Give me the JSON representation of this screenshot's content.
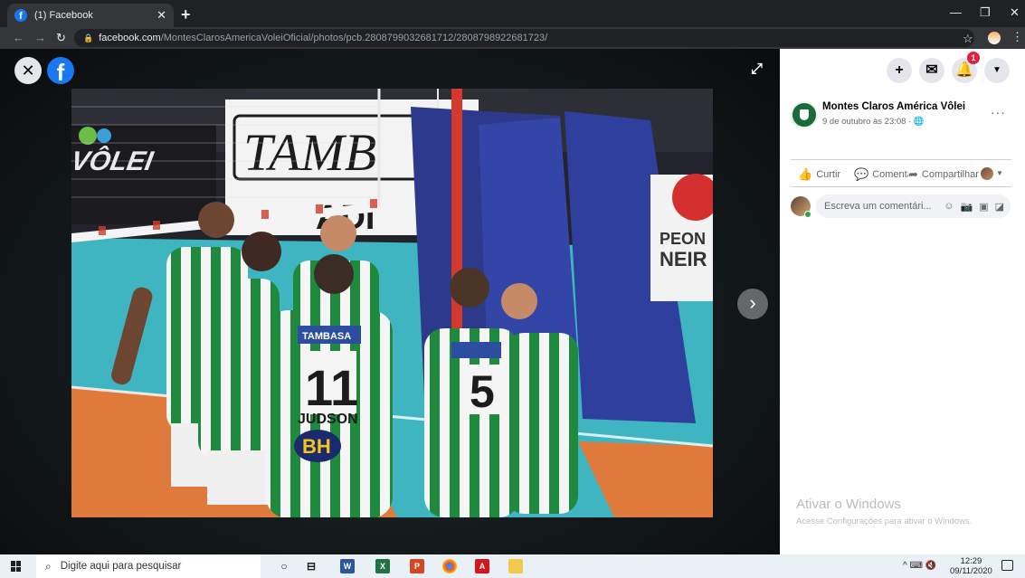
{
  "browser": {
    "tab_title": "(1) Facebook",
    "tab_close": "✕",
    "new_tab": "+",
    "url_host": "facebook.com",
    "url_path": "/MontesClarosAmericaVoleiOficial/photos/pcb.2808799032681712/2808798922681723/"
  },
  "viewer": {
    "close_icon": "✕",
    "logo_letter": "f",
    "expand_icon": "⤢",
    "next_icon": "›",
    "photo_texts": {
      "banner_left": "VÔLEI",
      "banner_center": "TAMB",
      "banner_sub": "ADI",
      "banner_right_1": "PEON",
      "banner_right_2": "NEIR",
      "jersey_sponsor": "TAMBASA",
      "jersey_number_a": "11",
      "jersey_name_a": "JUDSON",
      "jersey_number_b": "5",
      "bh_logo": "BH"
    }
  },
  "panel": {
    "notification_count": "1",
    "page_name": "Montes Claros América Vôlei",
    "post_time": "9 de outubro às 23:08 · 🌐",
    "more_icon": "···",
    "actions": {
      "like": "Curtir",
      "comment": "Comentar",
      "share": "Compartilhar"
    },
    "comment_placeholder": "Escreva um comentári...",
    "activate_title": "Ativar o Windows",
    "activate_sub": "Acesse Configurações para ativar o Windows."
  },
  "taskbar": {
    "search_placeholder": "Digite aqui para pesquisar",
    "time": "12:29",
    "date": "09/11/2020",
    "tray_text": "^ ⌨ 🔇"
  },
  "colors": {
    "facebook_blue": "#1877f2",
    "badge_red": "#e41e3f",
    "chrome_dark": "#202124",
    "taskbar_bg": "#e9f1f6"
  }
}
